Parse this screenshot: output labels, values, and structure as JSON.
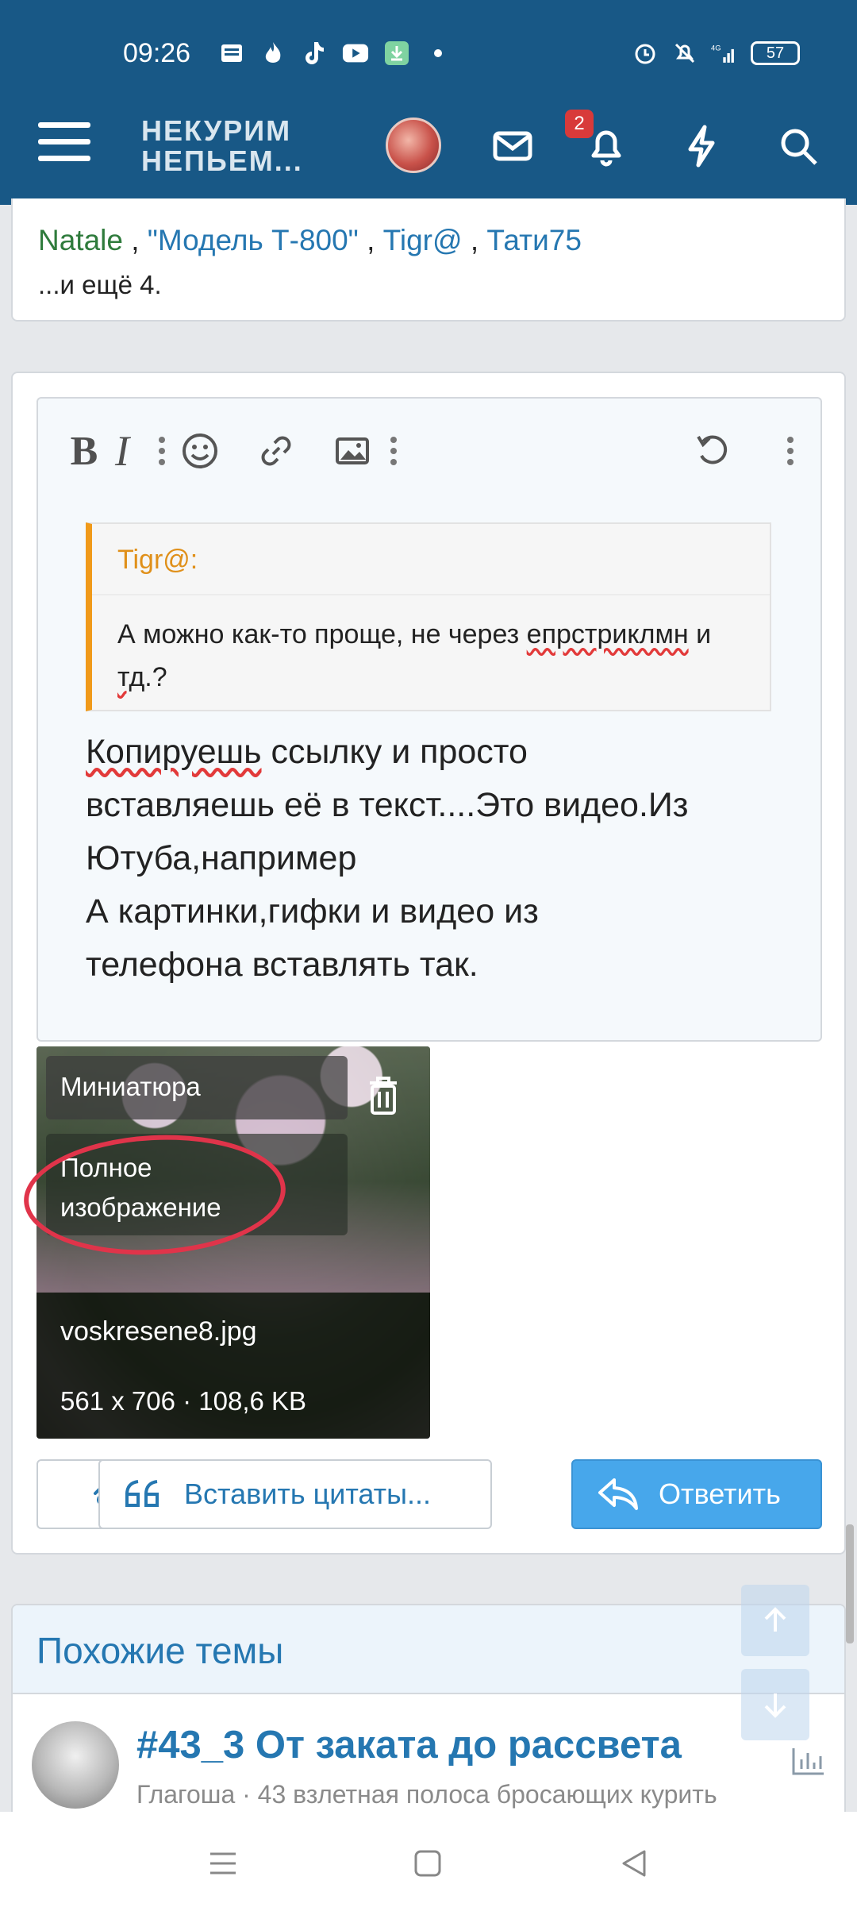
{
  "status_bar": {
    "time": "09:26",
    "battery": "57",
    "network": "4G"
  },
  "header": {
    "logo_line1": "НЕКУРИМ",
    "logo_line2": "НЕПЬЕМ...",
    "notifications_count": "2"
  },
  "likes": {
    "names": [
      "Natale",
      "\"Модель Т-800\"",
      "Tigr@",
      "Тати75"
    ],
    "more": "...и ещё 4."
  },
  "quote": {
    "author": "Tigr@:",
    "text_before": "А можно как-то проще, не через ",
    "text_misspelled": "епрстриклмн",
    "text_mid": " и ",
    "text_misspelled2": "тд",
    "text_end": ".?"
  },
  "editor": {
    "misspelled_word": "Копируешь",
    "line1_rest": " ссылку и просто",
    "line2": "вставляешь её в текст....Это видео.Из",
    "line3": "Ютуба,например",
    "line4": "А картинки,гифки и видео из",
    "line5": "телефона вставлять так."
  },
  "attachment": {
    "option_thumbnail": "Миниатюра",
    "option_full": "Полное изображение",
    "file_name": "voskresene8.jpg",
    "file_info": "561 x 706 · 108,6 KB"
  },
  "buttons": {
    "insert_quotes": "Вставить цитаты...",
    "reply": "Ответить"
  },
  "similar": {
    "heading": "Похожие темы",
    "thread_title": "#43_3 От заката до рассвета",
    "thread_meta": "Глагоша · 43 взлетная полоса бросающих курить"
  },
  "colors": {
    "header_bg": "#185886",
    "link": "#2577b1",
    "quote_accent": "#f09a1a",
    "reply_button": "#47a7eb"
  }
}
